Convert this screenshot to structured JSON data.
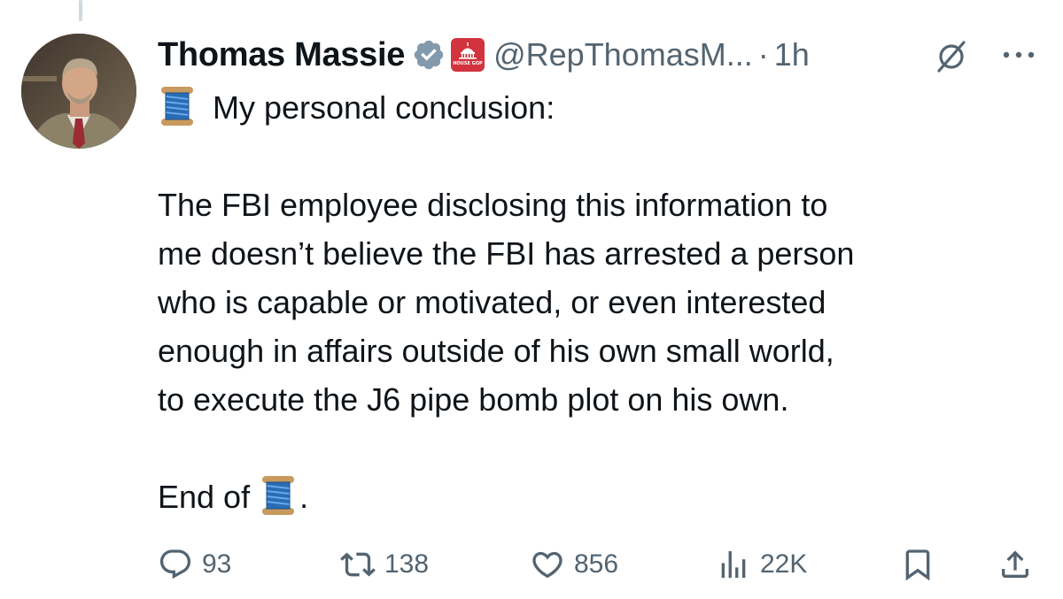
{
  "author": {
    "name": "Thomas Massie",
    "handle": "@RepThomasM...",
    "separator": "·",
    "time": "1h",
    "affiliation_badge_text": "HOUSE GOP",
    "verified_color": "#829aab",
    "affiliation_color": "#d1333f"
  },
  "tweet": {
    "lines": [
      "My personal conclusion:",
      "The FBI employee disclosing this information to",
      "me doesn’t believe the FBI has arrested a person",
      "who is capable or motivated, or even interested",
      "enough in affairs outside of his own small world,",
      "to execute the J6 pipe bomb plot on his own.",
      "End of",
      "."
    ],
    "thread_emoji_name": "spool-of-thread-emoji"
  },
  "actions": {
    "replies": "93",
    "retweets": "138",
    "likes": "856",
    "views": "22K"
  },
  "icons": {
    "grok": "grok-icon",
    "more": "more-icon",
    "reply": "reply-icon",
    "retweet": "retweet-icon",
    "like": "heart-icon",
    "views": "views-icon",
    "bookmark": "bookmark-icon",
    "share": "share-icon"
  },
  "colors": {
    "text": "#0f1419",
    "secondary": "#536471",
    "thread_line": "#cfd9de"
  }
}
